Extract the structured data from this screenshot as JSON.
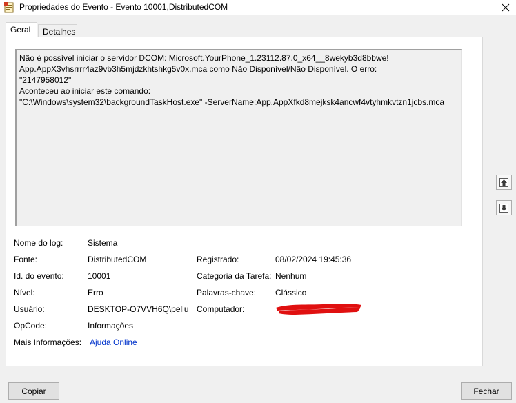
{
  "window": {
    "title": "Propriedades do Evento - Evento 10001,DistributedCOM"
  },
  "tabs": [
    {
      "label": "Geral",
      "active": true
    },
    {
      "label": "Detalhes",
      "active": false
    }
  ],
  "description": {
    "lines": [
      "Não é possível iniciar o servidor DCOM: Microsoft.YourPhone_1.23112.87.0_x64__8wekyb3d8bbwe!",
      "App.AppX3vhsrrrr4az9vb3h5mjdzkhtshkg5v0x.mca como Não Disponível/Não Disponível. O erro:",
      "\"2147958012\"",
      "Aconteceu ao iniciar este comando:",
      "\"C:\\Windows\\system32\\backgroundTaskHost.exe\" -ServerName:App.AppXfkd8mejksk4ancwf4vtyhmkvtzn1jcbs.mca"
    ]
  },
  "fields": {
    "log_name": {
      "label": "Nome do log:",
      "value": "Sistema"
    },
    "source": {
      "label": "Fonte:",
      "value": "DistributedCOM"
    },
    "logged": {
      "label": "Registrado:",
      "value": "08/02/2024 19:45:36"
    },
    "event_id": {
      "label": "Id. do evento:",
      "value": "10001"
    },
    "task_category": {
      "label": "Categoria da Tarefa:",
      "value": "Nenhum"
    },
    "level": {
      "label": "Nível:",
      "value": "Erro"
    },
    "keywords": {
      "label": "Palavras-chave:",
      "value": "Clássico"
    },
    "user": {
      "label": "Usuário:",
      "value": "DESKTOP-O7VVH6Q\\pellu"
    },
    "computer": {
      "label": "Computador:",
      "value": ""
    },
    "opcode": {
      "label": "OpCode:",
      "value": "Informações"
    },
    "more_info": {
      "label": "Mais Informações:",
      "link": "Ajuda Online"
    }
  },
  "buttons": {
    "copy": "Copiar",
    "close": "Fechar"
  },
  "colors": {
    "link": "#0033cc",
    "redaction": "#e01010"
  }
}
